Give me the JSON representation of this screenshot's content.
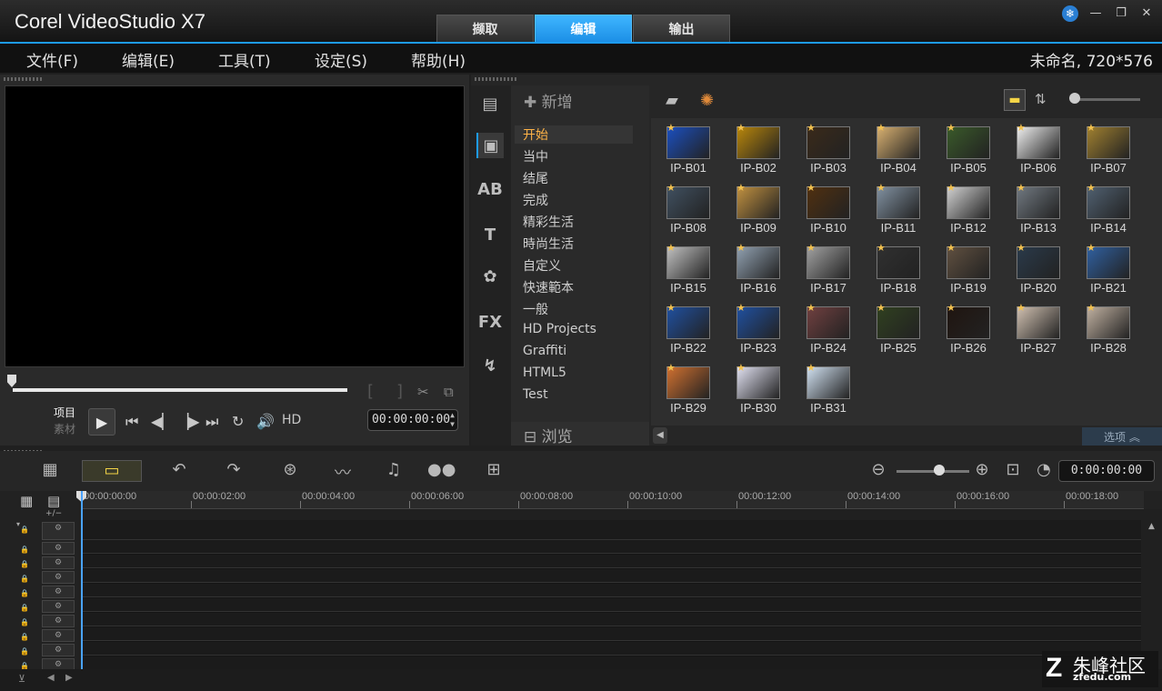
{
  "window": {
    "title": "Corel VideoStudio X7",
    "controls": [
      "❄",
      "—",
      "❐",
      "✕"
    ]
  },
  "tabs": [
    {
      "label": "撷取",
      "active": false
    },
    {
      "label": "编辑",
      "active": true
    },
    {
      "label": "输出",
      "active": false
    }
  ],
  "menu": {
    "items": [
      "文件(F)",
      "编辑(E)",
      "工具(T)",
      "设定(S)",
      "帮助(H)"
    ],
    "project_info": "未命名, 720*576"
  },
  "player": {
    "mode_project": "项目",
    "mode_clip": "素材",
    "hd_label": "HD",
    "timecode": "00:00:00:00"
  },
  "library": {
    "add_label": "新增",
    "browse_label": "浏览",
    "options_label": "选项",
    "fx_label": "FX",
    "categories": [
      {
        "label": "开始",
        "active": true
      },
      {
        "label": "当中"
      },
      {
        "label": "结尾"
      },
      {
        "label": "完成"
      },
      {
        "label": "精彩生活"
      },
      {
        "label": "時尚生活"
      },
      {
        "label": "自定义"
      },
      {
        "label": "快速範本"
      },
      {
        "label": "一般"
      },
      {
        "label": "HD Projects"
      },
      {
        "label": "Graffiti"
      },
      {
        "label": "HTML5"
      },
      {
        "label": "Test"
      }
    ],
    "templates": [
      "IP-B01",
      "IP-B02",
      "IP-B03",
      "IP-B04",
      "IP-B05",
      "IP-B06",
      "IP-B07",
      "IP-B08",
      "IP-B09",
      "IP-B10",
      "IP-B11",
      "IP-B12",
      "IP-B13",
      "IP-B14",
      "IP-B15",
      "IP-B16",
      "IP-B17",
      "IP-B18",
      "IP-B19",
      "IP-B20",
      "IP-B21",
      "IP-B22",
      "IP-B23",
      "IP-B24",
      "IP-B25",
      "IP-B26",
      "IP-B27",
      "IP-B28",
      "IP-B29",
      "IP-B30",
      "IP-B31"
    ]
  },
  "timeline": {
    "timecode": "0:00:00:00",
    "ruler_labels": [
      "00:00:00:00",
      "00:00:02:00",
      "00:00:04:00",
      "00:00:06:00",
      "00:00:08:00",
      "00:00:10:00",
      "00:00:12:00",
      "00:00:14:00",
      "00:00:16:00",
      "00:00:18:00"
    ],
    "track_count": 10,
    "add_remove_label": "+/−"
  },
  "watermark": {
    "text": "朱峰社区",
    "sub": "zfedu.com"
  },
  "colors": {
    "accent": "#1d9bf0",
    "active_category": "#ffb347"
  }
}
